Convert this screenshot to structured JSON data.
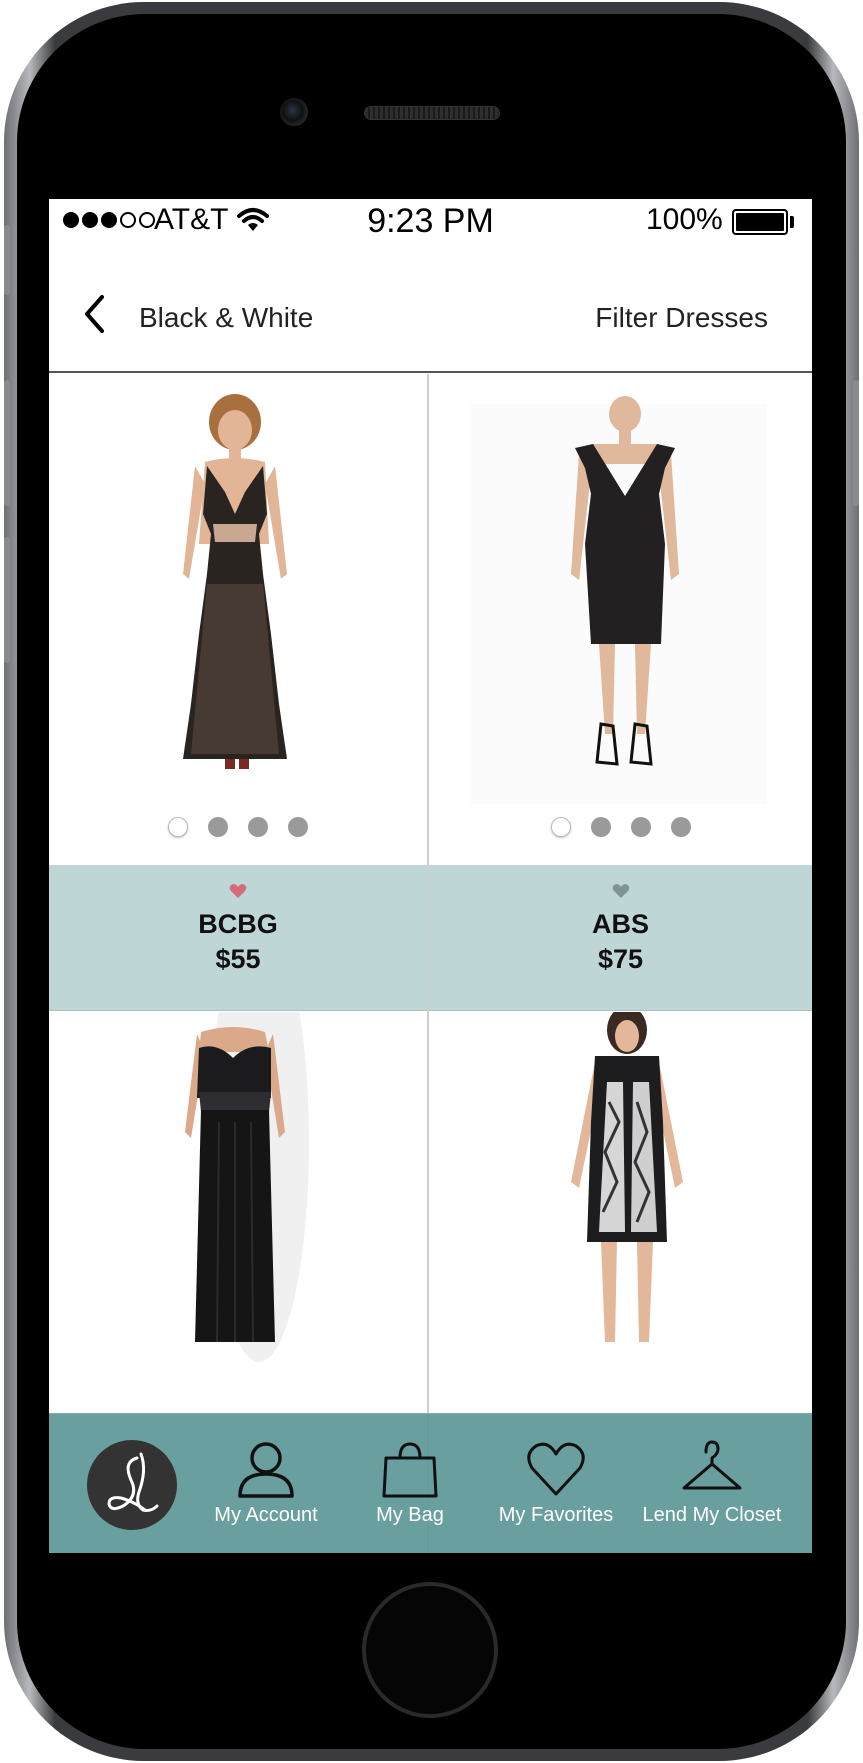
{
  "status_bar": {
    "signal_bars_filled": 3,
    "signal_bars_total": 5,
    "carrier": "AT&T",
    "time": "9:23 PM",
    "battery": "100%"
  },
  "nav": {
    "back_label": "Black & White",
    "filter_label": "Filter Dresses"
  },
  "products": [
    {
      "brand": "BCBG",
      "price": "$55",
      "favorited": true,
      "heart_color": "#d56a7a",
      "image_count": 4,
      "active_image": 1
    },
    {
      "brand": "ABS",
      "price": "$75",
      "favorited": false,
      "heart_color": "#7e9494",
      "image_count": 4,
      "active_image": 1
    },
    {
      "brand": "",
      "price": "",
      "favorited": false,
      "image_count": 0,
      "active_image": 0
    },
    {
      "brand": "",
      "price": "",
      "favorited": false,
      "image_count": 0,
      "active_image": 0
    }
  ],
  "tab_bar": {
    "logo_icon": "script-sl-logo-icon",
    "tabs": [
      {
        "label": "My Account",
        "icon": "person-icon"
      },
      {
        "label": "My Bag",
        "icon": "shopping-bag-icon"
      },
      {
        "label": "My Favorites",
        "icon": "heart-icon"
      },
      {
        "label": "Lend My Closet",
        "icon": "hanger-icon"
      }
    ]
  },
  "colors": {
    "info_band": "#bfd6d6",
    "tab_bar": "#609998",
    "logo_bg": "#333333"
  }
}
